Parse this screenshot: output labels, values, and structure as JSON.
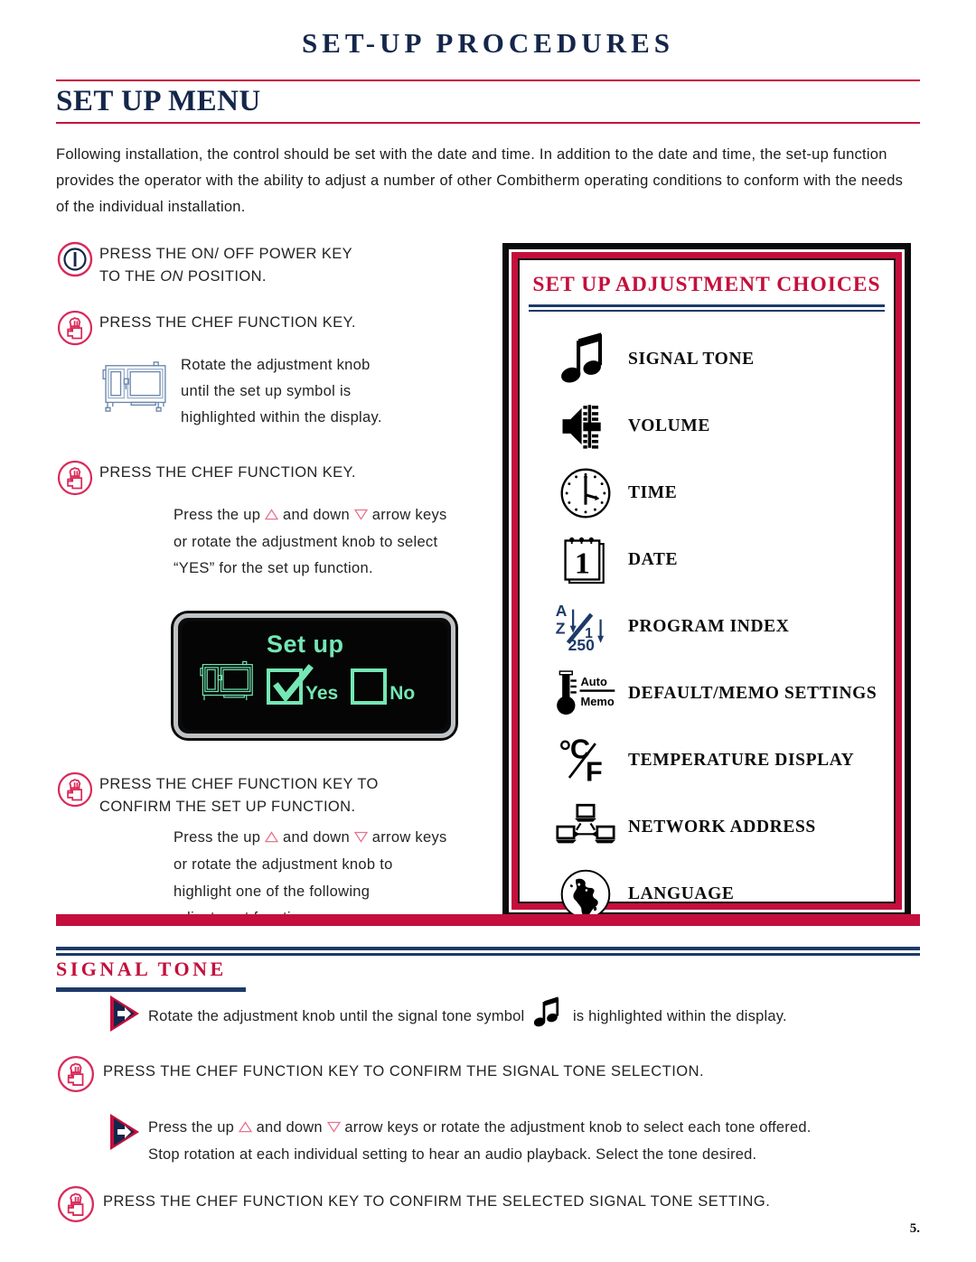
{
  "header": {
    "doc_title": "SET-UP PROCEDURES",
    "section_title": "SET UP MENU"
  },
  "intro": {
    "paragraph": "Following installation, the control should be set with the date and time. In addition to the date and time, the set-up function provides the operator with the ability to adjust a number of other Combitherm operating conditions to conform with the needs of the individual installation."
  },
  "steps": {
    "step1": {
      "icon": "power-key-icon",
      "line1": "PRESS THE ON/ OFF POWER KEY",
      "line2_a": "TO THE ",
      "line2_italic": "ON",
      "line2_b": " POSITION."
    },
    "step2": {
      "icon": "chef-function-key-icon",
      "line1": "PRESS THE CHEF FUNCTION KEY.",
      "sub_line1": "Rotate the adjustment knob",
      "sub_line2": "until the set up symbol is",
      "sub_line3": "highlighted within the display."
    },
    "step3": {
      "icon": "chef-function-key-icon",
      "line1": "PRESS THE CHEF FUNCTION KEY.",
      "sub_pre": "Press the up",
      "sub_mid": "and down",
      "sub_post": "arrow keys",
      "sub_line2": "or rotate the adjustment knob to select",
      "sub_line3": "“YES” for the set up function."
    },
    "step4": {
      "icon": "chef-function-key-icon",
      "line1": "PRESS THE CHEF FUNCTION KEY TO",
      "line2": "CONFIRM THE SET UP FUNCTION.",
      "sub_pre": "Press the up",
      "sub_mid": "and down",
      "sub_post": "arrow keys",
      "sub_line2": "or rotate the adjustment knob to",
      "sub_line3": "highlight one of the following",
      "sub_line4": "adjustment functions:"
    }
  },
  "lcd_display": {
    "title": "Set up",
    "oven_icon": "combi-oven-icon",
    "yes_label": "Yes",
    "no_label": "No",
    "yes_checked": true,
    "no_checked": false,
    "screen_color": "#050505",
    "text_color": "#74e7b4"
  },
  "adjustment_panel": {
    "title": "SET UP ADJUSTMENT CHOICES",
    "border_color": "#c40f3c",
    "title_color": "#c40f3c",
    "rule_color": "#1d3a68",
    "choices": [
      {
        "icon": "music-note-icon",
        "label": "SIGNAL TONE"
      },
      {
        "icon": "speaker-volume-icon",
        "label": "VOLUME"
      },
      {
        "icon": "clock-icon",
        "label": "TIME"
      },
      {
        "icon": "calendar-icon",
        "label": "DATE"
      },
      {
        "icon": "program-index-icon",
        "label": "PROGRAM INDEX"
      },
      {
        "icon": "thermometer-auto-memo-icon",
        "label": "DEFAULT/MEMO SETTINGS"
      },
      {
        "icon": "celsius-fahrenheit-icon",
        "label": "TEMPERATURE DISPLAY"
      },
      {
        "icon": "network-computers-icon",
        "label": "NETWORK ADDRESS"
      },
      {
        "icon": "globe-icon",
        "label": "LANGUAGE"
      }
    ],
    "program_index_glyphs": {
      "from": "A",
      "to": "Z",
      "num_top": "1",
      "num_bottom": "250"
    },
    "memo_glyphs": {
      "top": "Auto",
      "bottom": "Memo"
    },
    "temp_glyphs": {
      "degree": "°",
      "celsius": "C",
      "fahrenheit": "F"
    },
    "calendar_glyph": "1"
  },
  "signal_tone_section": {
    "heading": "SIGNAL TONE",
    "row1_pre": "Rotate the adjustment knob until the signal tone symbol",
    "row1_post": "is highlighted within the display.",
    "row2": "PRESS THE CHEF FUNCTION KEY TO CONFIRM THE SIGNAL TONE SELECTION.",
    "row3_pre": "Press the up",
    "row3_mid": "and down",
    "row3_post": "arrow keys or rotate the adjustment knob to select each tone offered.",
    "row3_line2": "Stop rotation at each individual setting to hear an audio playback. Select the tone desired.",
    "row4": "PRESS THE CHEF FUNCTION KEY TO CONFIRM THE SELECTED SIGNAL TONE SETTING."
  },
  "footer": {
    "page_number": "5."
  },
  "colors": {
    "navy": "#14264a",
    "crimson": "#c40f3c",
    "lcd_green": "#74e7b4",
    "rule_navy": "#1d3a68"
  }
}
